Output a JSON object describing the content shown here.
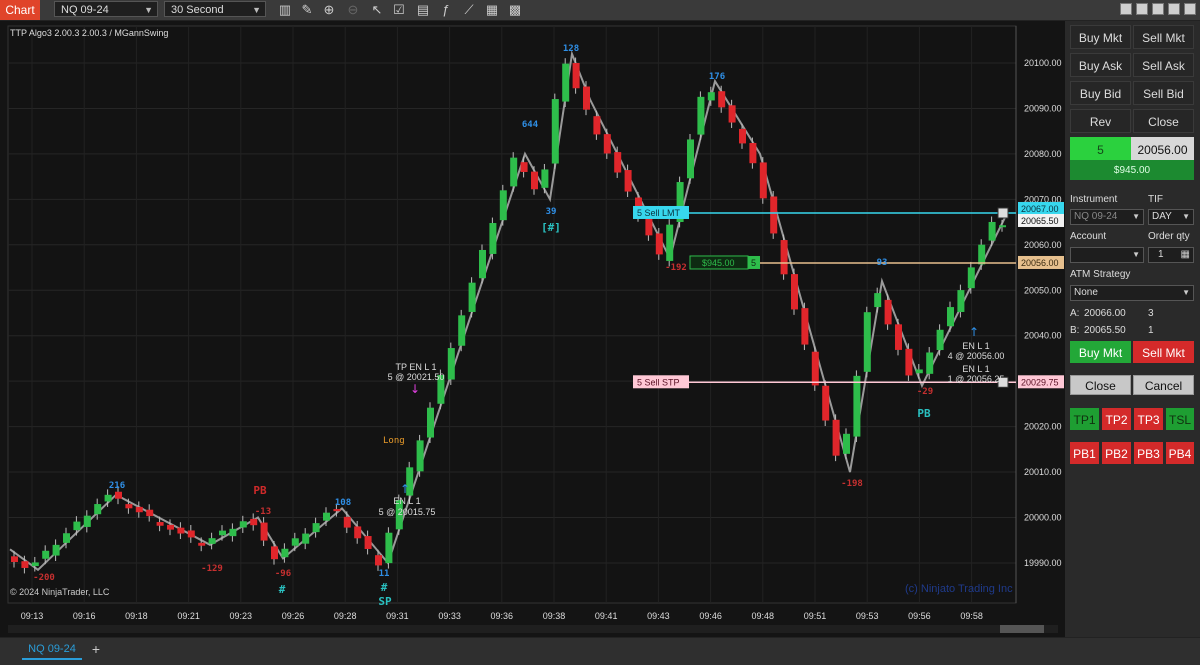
{
  "toolbar": {
    "app_tab": "Chart",
    "instrument": "NQ 09-24",
    "interval": "30 Second",
    "icons": [
      "bars-icon",
      "pencil-icon",
      "zoom-in-icon",
      "zoom-out-icon",
      "cursor-icon",
      "properties-icon",
      "data-box-icon",
      "indicators-icon",
      "strategies-icon",
      "templates-icon"
    ]
  },
  "chart": {
    "title": "TTP Algo3 2.00.3 2.00.3 / MGannSwing",
    "copyright": "© 2024 NinjaTrader, LLC",
    "watermark": "(c) Ninjato Trading Inc",
    "y_ticks": [
      "20100.00",
      "20090.00",
      "20080.00",
      "20070.00",
      "20060.00",
      "20050.00",
      "20040.00",
      "20030.00",
      "20020.00",
      "20010.00",
      "20000.00",
      "19990.00"
    ],
    "x_ticks": [
      "09:13",
      "09:16",
      "09:18",
      "09:21",
      "09:23",
      "09:26",
      "09:28",
      "09:31",
      "09:33",
      "09:36",
      "09:38",
      "09:41",
      "09:43",
      "09:46",
      "09:48",
      "09:51",
      "09:53",
      "09:56",
      "09:58"
    ],
    "price_tags": {
      "upper_small": "20067.00",
      "sell_lmt_price": "20065.50",
      "position_price": "20056.00",
      "sell_stp_price": "20029.75"
    },
    "order_lines": {
      "sell_lmt": "5  Sell LMT",
      "sell_stp": "5  Sell STP",
      "pnl": "$945.00",
      "pnl_qty": "5"
    },
    "swing_labels": {
      "l1": "-200",
      "h1": "216",
      "l2": "-129",
      "l3": "-96",
      "h2": "108",
      "l4": "11",
      "h3": "644",
      "l5": "39",
      "h4": "128",
      "l6": "-192",
      "h5": "176",
      "l7": "-198",
      "h6": "93",
      "l8": "-29",
      "pb_red_num": "-13"
    },
    "markers": {
      "pb_red": "PB",
      "hash1": "#",
      "hash2": "#",
      "sp": "SP",
      "bracket": "[#]",
      "pb_cyan": "PB",
      "long": "Long"
    },
    "trade_labels": {
      "tp_l1": "TP EN L 1",
      "tp_l1_fill": "5 @ 20021.50",
      "en_l1_a": "EN L 1",
      "en_l1_a_fill": "5 @ 20015.75",
      "en_l1_b": "EN L 1",
      "en_l1_b_fill": "4 @ 20056.00",
      "en_l1_c": "EN L 1",
      "en_l1_c_fill": "1 @ 20056.25"
    }
  },
  "panel": {
    "buy_mkt": "Buy Mkt",
    "sell_mkt": "Sell Mkt",
    "buy_ask": "Buy Ask",
    "sell_ask": "Sell Ask",
    "buy_bid": "Buy Bid",
    "sell_bid": "Sell Bid",
    "rev": "Rev",
    "close": "Close",
    "position_qty": "5",
    "position_price": "20056.00",
    "pnl": "$945.00",
    "instrument_label": "Instrument",
    "tif_label": "TIF",
    "instrument_value": "NQ 09-24",
    "tif_value": "DAY",
    "account_label": "Account",
    "order_qty_label": "Order qty",
    "order_qty": "1",
    "atm_label": "ATM Strategy",
    "atm_value": "None",
    "a_label": "A:",
    "a_price": "20066.00",
    "a_qty": "3",
    "b_label": "B:",
    "b_price": "20065.50",
    "b_qty": "1",
    "buy_mkt2": "Buy Mkt",
    "sell_mkt2": "Sell Mkt",
    "close2": "Close",
    "cancel": "Cancel",
    "tp": [
      "TP1",
      "TP2",
      "TP3",
      "TSL"
    ],
    "pb": [
      "PB1",
      "PB2",
      "PB3",
      "PB4"
    ]
  },
  "bottom": {
    "tab": "NQ 09-24",
    "add": "+"
  },
  "colors": {
    "up": "#2ebd4b",
    "down": "#e0262b",
    "swing": "#9a9a9a",
    "cyan": "#37d7ee",
    "pink": "#ffc8d6",
    "tan": "#e7c08e"
  }
}
